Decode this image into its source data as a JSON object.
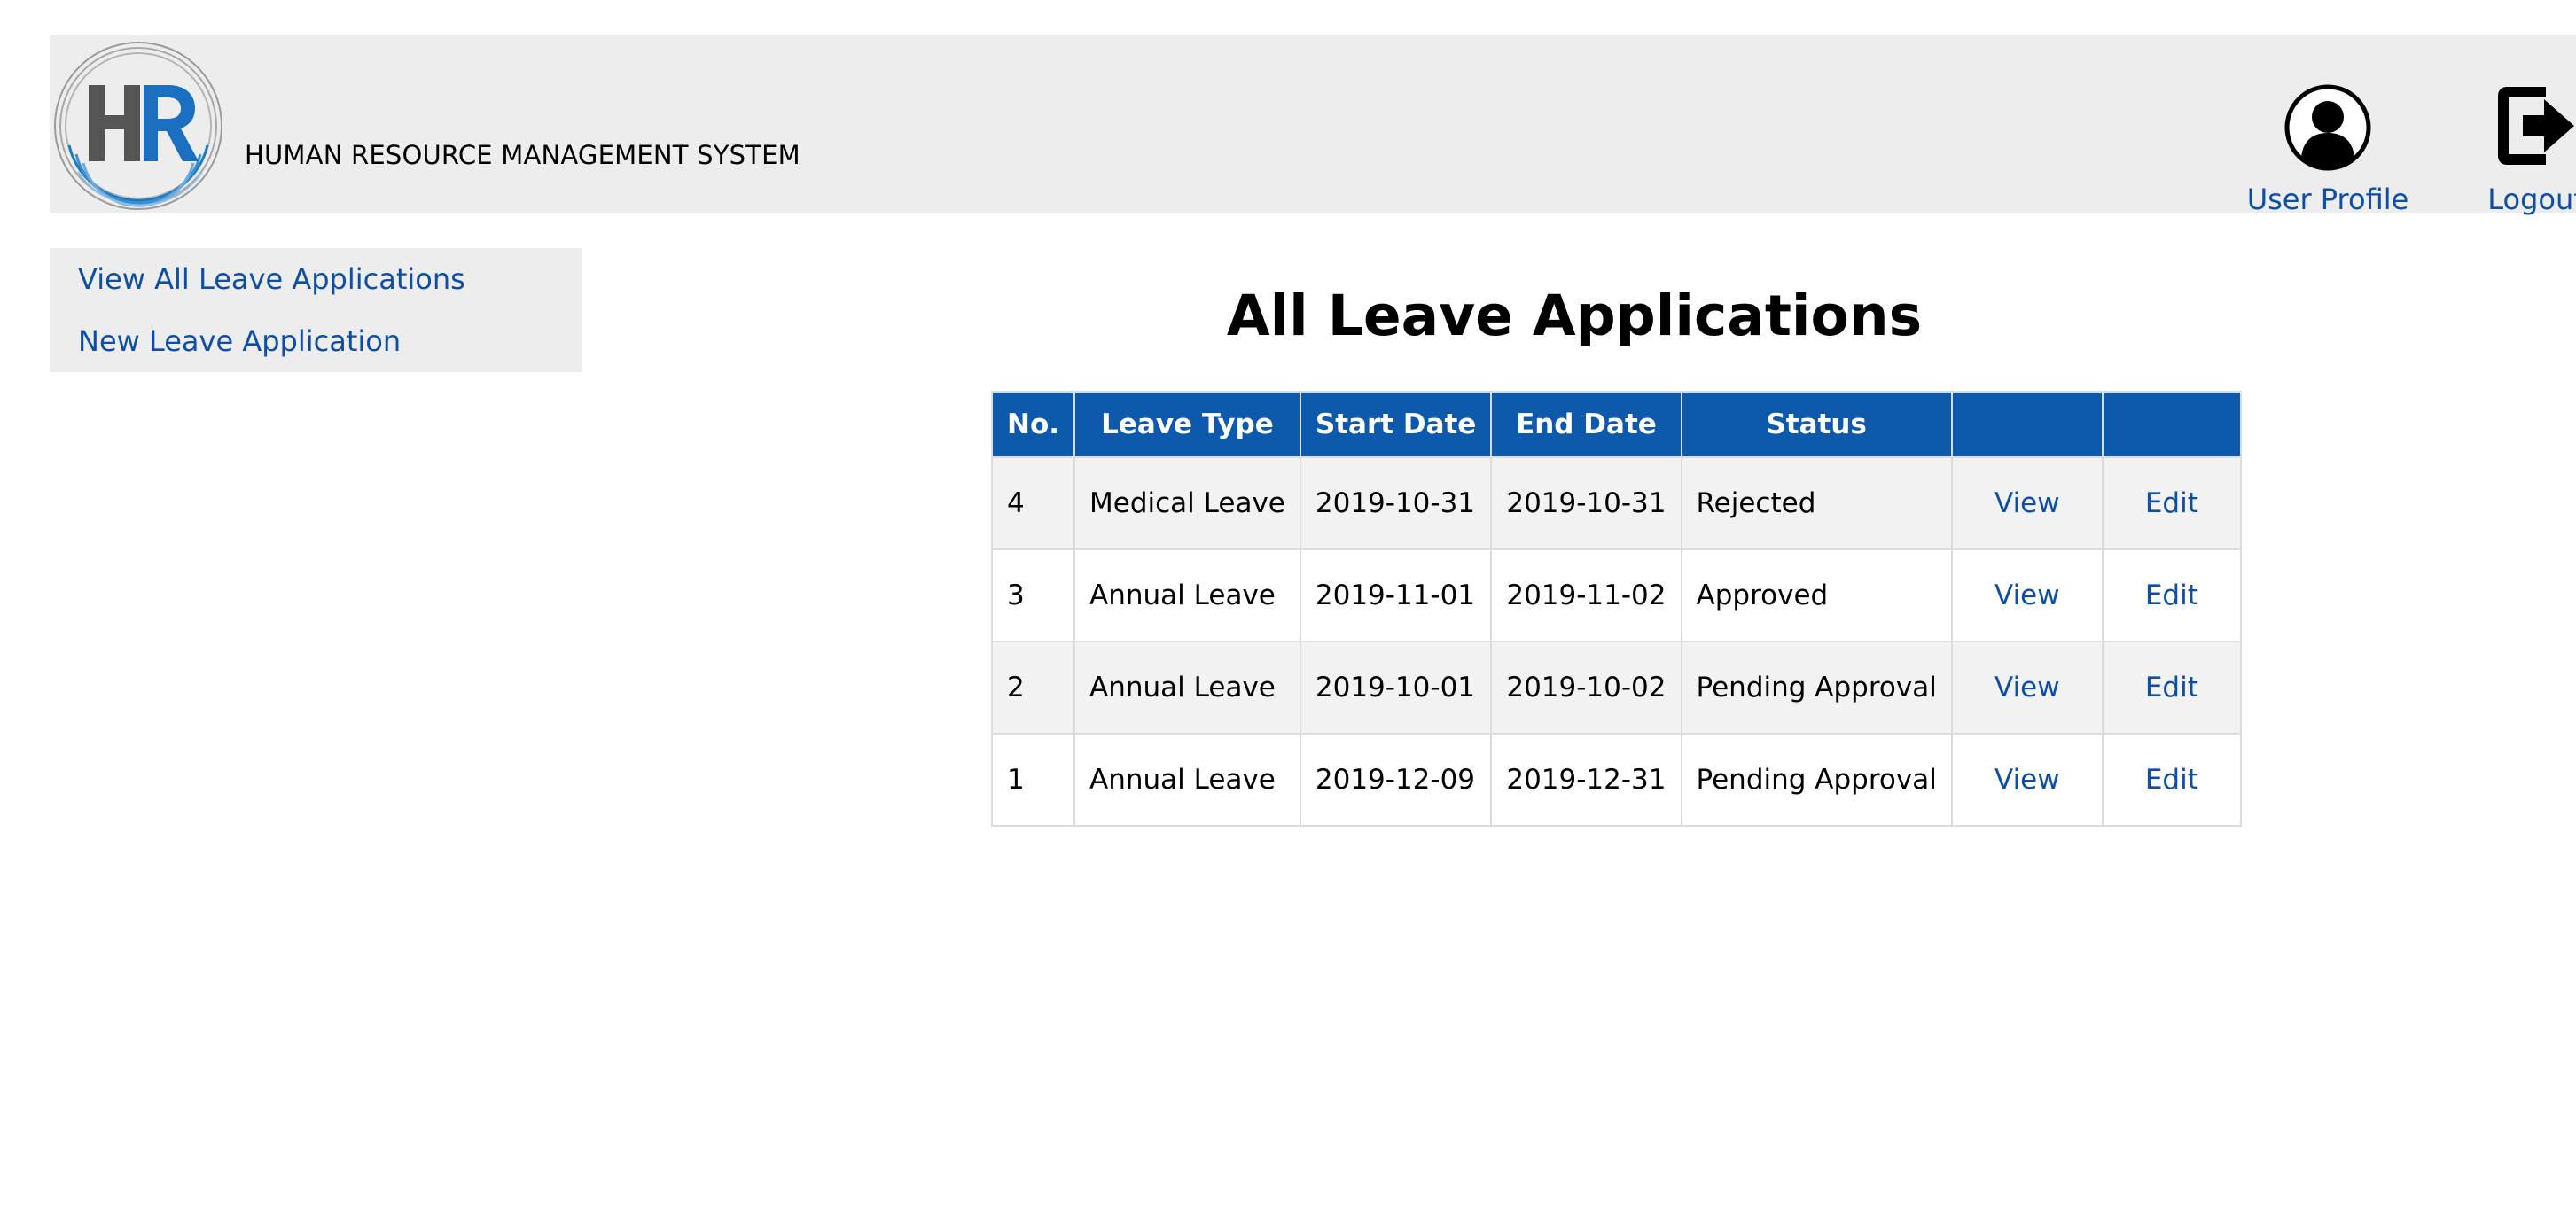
{
  "header": {
    "app_title": "HUMAN RESOURCE MANAGEMENT SYSTEM",
    "logo_text": "HR",
    "user_profile_label": "User Profile",
    "logout_label": "Logout"
  },
  "sidebar": {
    "items": [
      {
        "label": "View All Leave Applications"
      },
      {
        "label": "New Leave Application"
      }
    ]
  },
  "main": {
    "title": "All Leave Applications",
    "table": {
      "columns": [
        "No.",
        "Leave Type",
        "Start Date",
        "End Date",
        "Status",
        "",
        ""
      ],
      "rows": [
        {
          "no": "4",
          "leave_type": "Medical Leave",
          "start_date": "2019-10-31",
          "end_date": "2019-10-31",
          "status": "Rejected",
          "view": "View",
          "edit": "Edit"
        },
        {
          "no": "3",
          "leave_type": "Annual Leave",
          "start_date": "2019-11-01",
          "end_date": "2019-11-02",
          "status": "Approved",
          "view": "View",
          "edit": "Edit"
        },
        {
          "no": "2",
          "leave_type": "Annual Leave",
          "start_date": "2019-10-01",
          "end_date": "2019-10-02",
          "status": "Pending Approval",
          "view": "View",
          "edit": "Edit"
        },
        {
          "no": "1",
          "leave_type": "Annual Leave",
          "start_date": "2019-12-09",
          "end_date": "2019-12-31",
          "status": "Pending Approval",
          "view": "View",
          "edit": "Edit"
        }
      ]
    }
  },
  "icons": {
    "logo": "hr-logo",
    "user": "user-circle-icon",
    "logout": "sign-out-icon"
  },
  "colors": {
    "header_bg": "#ededed",
    "table_header_bg": "#0d5aad",
    "link": "#0d4ea6"
  }
}
